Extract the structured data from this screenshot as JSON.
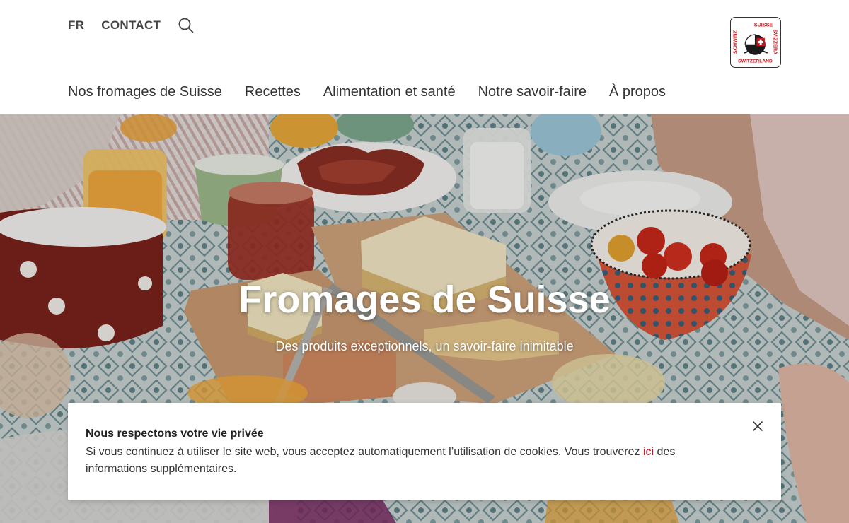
{
  "header": {
    "lang_label": "FR",
    "contact_label": "CONTACT",
    "logo_text": {
      "left": "SCHWEIZ",
      "top": "SUISSE",
      "right": "SVIZZERA",
      "bottom": "SWITZERLAND"
    }
  },
  "nav": {
    "items": [
      {
        "label": "Nos fromages de Suisse"
      },
      {
        "label": "Recettes"
      },
      {
        "label": "Alimentation et santé"
      },
      {
        "label": "Notre savoir-faire"
      },
      {
        "label": "À propos"
      }
    ]
  },
  "hero": {
    "title": "Fromages de Suisse",
    "subtitle": "Des produits exceptionnels, un savoir-faire inimitable"
  },
  "cookie": {
    "title": "Nous respectons votre vie privée",
    "text_before": "Si vous continuez à utiliser le site web, vous acceptez automatiquement l’utilisation de cookies. Vous trouverez ",
    "link_label": "ici",
    "text_after": " des informations supplémentaires."
  },
  "colors": {
    "brand_red": "#c4161c",
    "text_dark": "#333333"
  },
  "icons": {
    "search": "search-icon",
    "close": "close-icon",
    "logo": "swiss-cheese-logo-icon"
  }
}
